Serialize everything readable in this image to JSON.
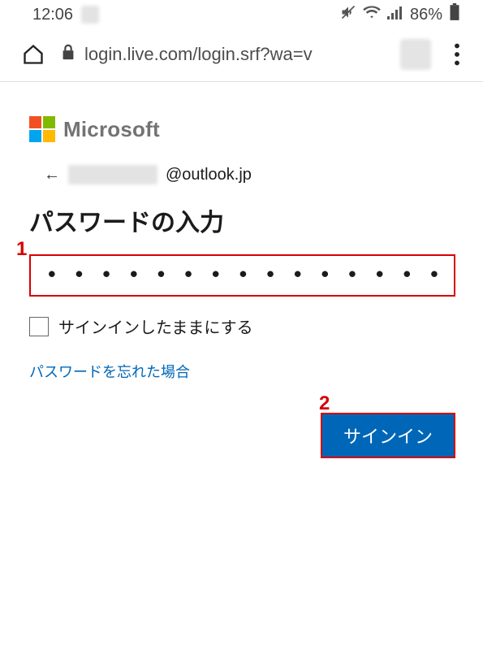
{
  "status": {
    "time": "12:06",
    "battery_pct": "86%"
  },
  "browser": {
    "url_display": "login.live.com/login.srf?wa=v"
  },
  "ms": {
    "brand": "Microsoft",
    "identity_domain": "@outlook.jp"
  },
  "form": {
    "title": "パスワードの入力",
    "password_masked": "••••••••••••••••••••••••",
    "keep_signed_in_label": "サインインしたままにする",
    "forgot_password_label": "パスワードを忘れた場合",
    "signin_button_label": "サインイン"
  },
  "callouts": {
    "c1": "1",
    "c2": "2"
  }
}
